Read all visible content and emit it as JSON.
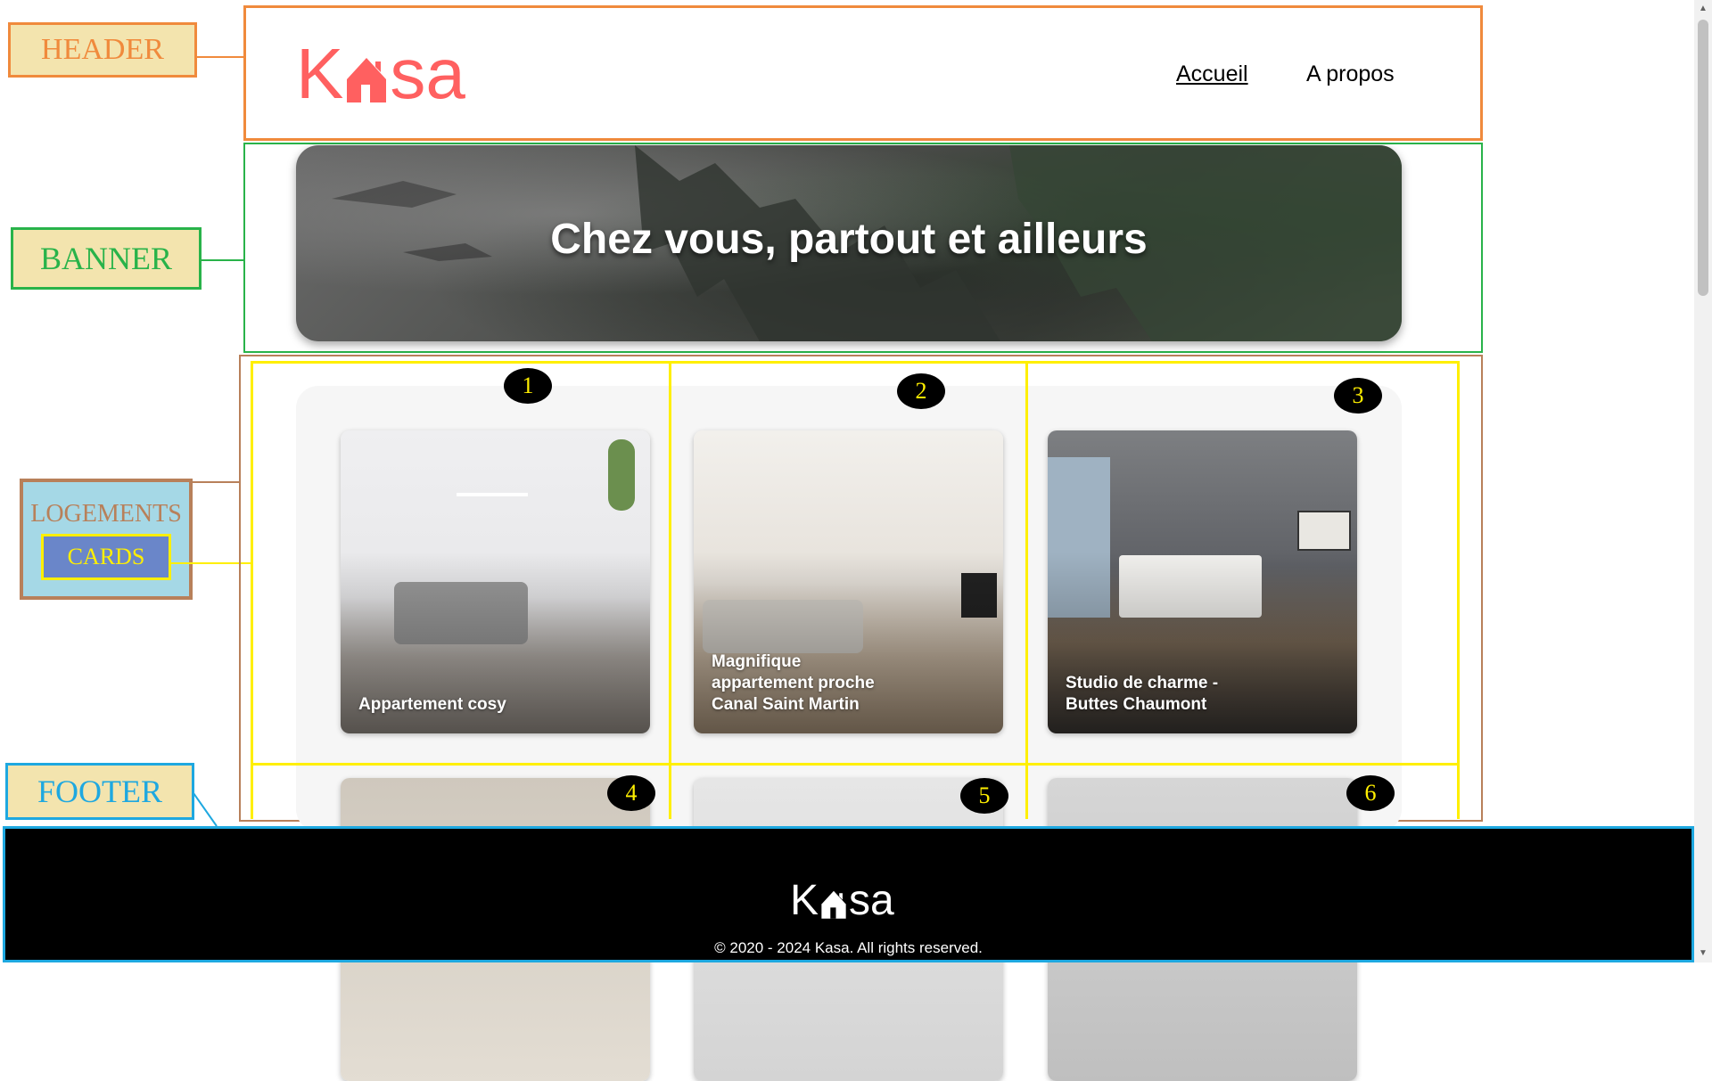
{
  "annotations": {
    "header": "HEADER",
    "banner": "BANNER",
    "logements": "LOGEMENTS",
    "cards": "CARDS",
    "footer": "FOOTER"
  },
  "header": {
    "logo_text": "Kasa",
    "nav": [
      "Accueil",
      "A propos"
    ]
  },
  "banner": {
    "title": "Chez vous, partout et ailleurs"
  },
  "logements": {
    "cards": [
      {
        "number": "1",
        "title": "Appartement cosy"
      },
      {
        "number": "2",
        "title": "Magnifique\nappartement proche\nCanal Saint Martin"
      },
      {
        "number": "3",
        "title": "Studio de charme -\nButtes Chaumont"
      },
      {
        "number": "4",
        "title": ""
      },
      {
        "number": "5",
        "title": ""
      },
      {
        "number": "6",
        "title": ""
      }
    ]
  },
  "footer": {
    "logo_text": "Kasa",
    "copyright": "© 2020 - 2024 Kasa. All rights reserved."
  },
  "colors": {
    "brand": "#ff6060",
    "header_frame": "#f08a3c",
    "banner_frame": "#29b34a",
    "logements_frame": "#b8805a",
    "cards_frame": "#ffef00",
    "footer_frame": "#1ea8e0"
  }
}
